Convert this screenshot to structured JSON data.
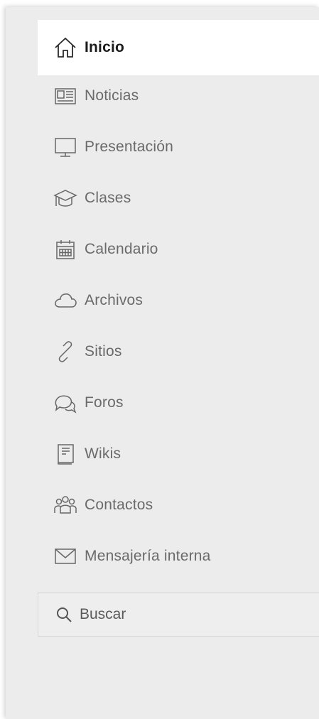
{
  "sidebar": {
    "items": [
      {
        "label": "Inicio",
        "icon": "home-icon",
        "active": true
      },
      {
        "label": "Noticias",
        "icon": "newspaper-icon"
      },
      {
        "label": "Presentación",
        "icon": "monitor-icon"
      },
      {
        "label": "Clases",
        "icon": "graduation-cap-icon"
      },
      {
        "label": "Calendario",
        "icon": "calendar-icon"
      },
      {
        "label": "Archivos",
        "icon": "cloud-icon"
      },
      {
        "label": "Sitios",
        "icon": "link-icon"
      },
      {
        "label": "Foros",
        "icon": "chat-bubbles-icon"
      },
      {
        "label": "Wikis",
        "icon": "book-icon"
      },
      {
        "label": "Contactos",
        "icon": "people-icon"
      },
      {
        "label": "Mensajería interna",
        "icon": "envelope-icon"
      }
    ],
    "search": {
      "placeholder": "Buscar",
      "icon": "search-icon"
    }
  }
}
